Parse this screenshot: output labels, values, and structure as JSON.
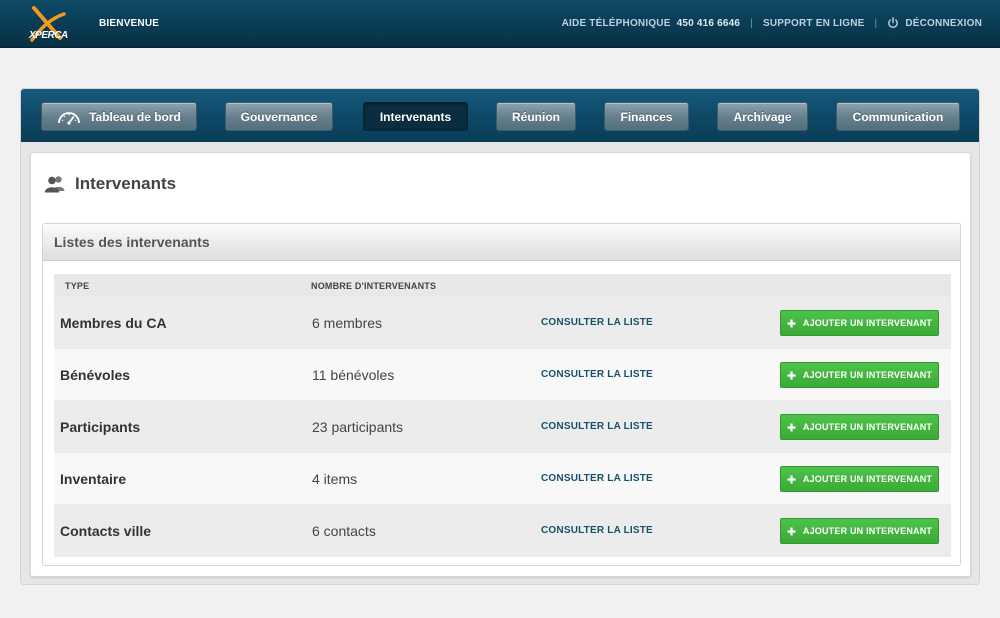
{
  "header": {
    "logo_text": "XPERCA",
    "welcome": "BIENVENUE",
    "phone_label": "AIDE TÉLÉPHONIQUE",
    "phone_number": "450 416 6646",
    "support": "SUPPORT EN LIGNE",
    "logout": "DÉCONNEXION",
    "separator": "|"
  },
  "nav": {
    "items": [
      {
        "label": "Tableau de bord",
        "icon": "gauge-icon"
      },
      {
        "label": "Gouvernance"
      },
      {
        "label": "Intervenants",
        "active": true
      },
      {
        "label": "Réunion"
      },
      {
        "label": "Finances"
      },
      {
        "label": "Archivage"
      },
      {
        "label": "Communication"
      }
    ]
  },
  "page": {
    "title": "Intervenants",
    "title_icon": "users-icon"
  },
  "list": {
    "title": "Listes des intervenants",
    "columns": [
      "TYPE",
      "NOMBRE D'INTERVENANTS"
    ],
    "consult_label": "CONSULTER LA LISTE",
    "add_label": "AJOUTER UN INTERVENANT",
    "rows": [
      {
        "type": "Membres du CA",
        "count": "6 membres"
      },
      {
        "type": "Bénévoles",
        "count": "11 bénévoles"
      },
      {
        "type": "Participants",
        "count": "23 participants"
      },
      {
        "type": "Inventaire",
        "count": "4 items"
      },
      {
        "type": "Contacts ville",
        "count": "6 contacts"
      }
    ]
  },
  "colors": {
    "header_bg": "#0a3a52",
    "nav_active": "#0a2d40",
    "add_button": "#3aab36",
    "link": "#17506b",
    "logo_accent": "#f39a1e"
  }
}
